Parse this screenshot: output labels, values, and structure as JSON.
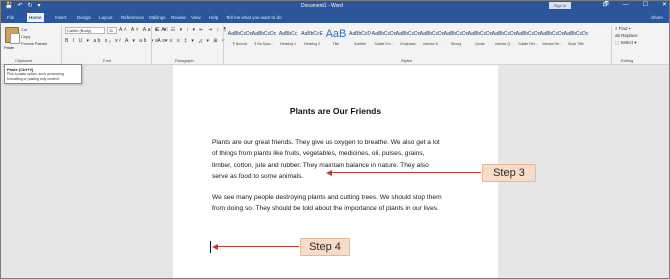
{
  "window": {
    "title": "Document1 - Word",
    "signin_label": "Sign in",
    "quick_access": [
      "💾",
      "↶",
      "↻",
      "▾"
    ],
    "controls": [
      "🗗",
      "—",
      "☐",
      "✕"
    ]
  },
  "tabs": {
    "items": [
      "File",
      "Home",
      "Insert",
      "Design",
      "Layout",
      "References",
      "Mailings",
      "Review",
      "View",
      "Help"
    ],
    "active": "Home",
    "tell_me": "Tell me what you want to do",
    "share": "Share"
  },
  "ribbon": {
    "clipboard": {
      "paste_label": "Paste",
      "items": [
        "Cut",
        "Copy",
        "Format Painter"
      ],
      "group_label": "Clipboard"
    },
    "font": {
      "family_value": "Calibri (Body)",
      "size_value": "11",
      "row1": "A˄ A˅ Aa ▾ A⃠",
      "row2": "B I U ▾ ab x₂ x² A ▾ ab ▾ A ▾",
      "group_label": "Font"
    },
    "paragraph": {
      "row1": "☰ ▾ ☷ ▾ ⁝ ▾ ⇤ ⇥ ↕ ¶",
      "row2": "≡ ≡ ≡ ≡ ‡ ▾ ◿ ▾ ⊞ ▾",
      "group_label": "Paragraph"
    },
    "styles": {
      "items": [
        {
          "sample": "AaBbCcDc",
          "name": "¶ Normal"
        },
        {
          "sample": "AaBbCcDc",
          "name": "¶ No Spac..."
        },
        {
          "sample": "AaBbCc",
          "name": "Heading 1"
        },
        {
          "sample": "AaBbCcE",
          "name": "Heading 2"
        },
        {
          "sample": "AaB",
          "name": "Title"
        },
        {
          "sample": "AaBbCcD",
          "name": "Subtitle"
        },
        {
          "sample": "AaBbCcDc",
          "name": "Subtle Em..."
        },
        {
          "sample": "AaBbCcDc",
          "name": "Emphasis"
        },
        {
          "sample": "AaBbCcDc",
          "name": "Intense E..."
        },
        {
          "sample": "AaBbCcDc",
          "name": "Strong"
        },
        {
          "sample": "AaBbCcDc",
          "name": "Quote"
        },
        {
          "sample": "AaBbCcDc",
          "name": "Intense Q..."
        },
        {
          "sample": "AaBbCcDc",
          "name": "Subtle Ref..."
        },
        {
          "sample": "AaBbCcDc",
          "name": "Intense Re..."
        },
        {
          "sample": "AaBbCcDc",
          "name": "Book Title"
        }
      ],
      "group_label": "Styles"
    },
    "editing": {
      "items": [
        "⌕ Find ▾",
        "ab Replace",
        "⬚ Select ▾"
      ],
      "group_label": "Editing"
    }
  },
  "tooltip": {
    "title": "Paste (Ctrl+V)",
    "body": "Pick a paste option, such as keeping formatting or pasting only content."
  },
  "document": {
    "heading": "Plants are Our Friends",
    "paragraph1_lines": [
      "Plants are our great friends. They give us oxygen to breathe. We also get a lot",
      "of things from plants like fruits, vegetables, medicines, oil, pulses, grains,",
      "timber, cotton, jute and rubber. They maintain balance in nature. They also",
      "serve as food to some animals."
    ],
    "paragraph2_lines": [
      "We see many people destroying plants and cutting trees. We should stop them",
      "from doing so. They should be told about the importance of plants in our lives."
    ]
  },
  "annotations": {
    "step3": "Step 3",
    "step4": "Step 4",
    "color": "#c0392b",
    "box_color": "#f8dcc8"
  },
  "colors": {
    "titlebar": "#2b579a",
    "ribbon": "#f3f3f3",
    "document_bg": "#e6e6e6",
    "page": "#ffffff"
  }
}
